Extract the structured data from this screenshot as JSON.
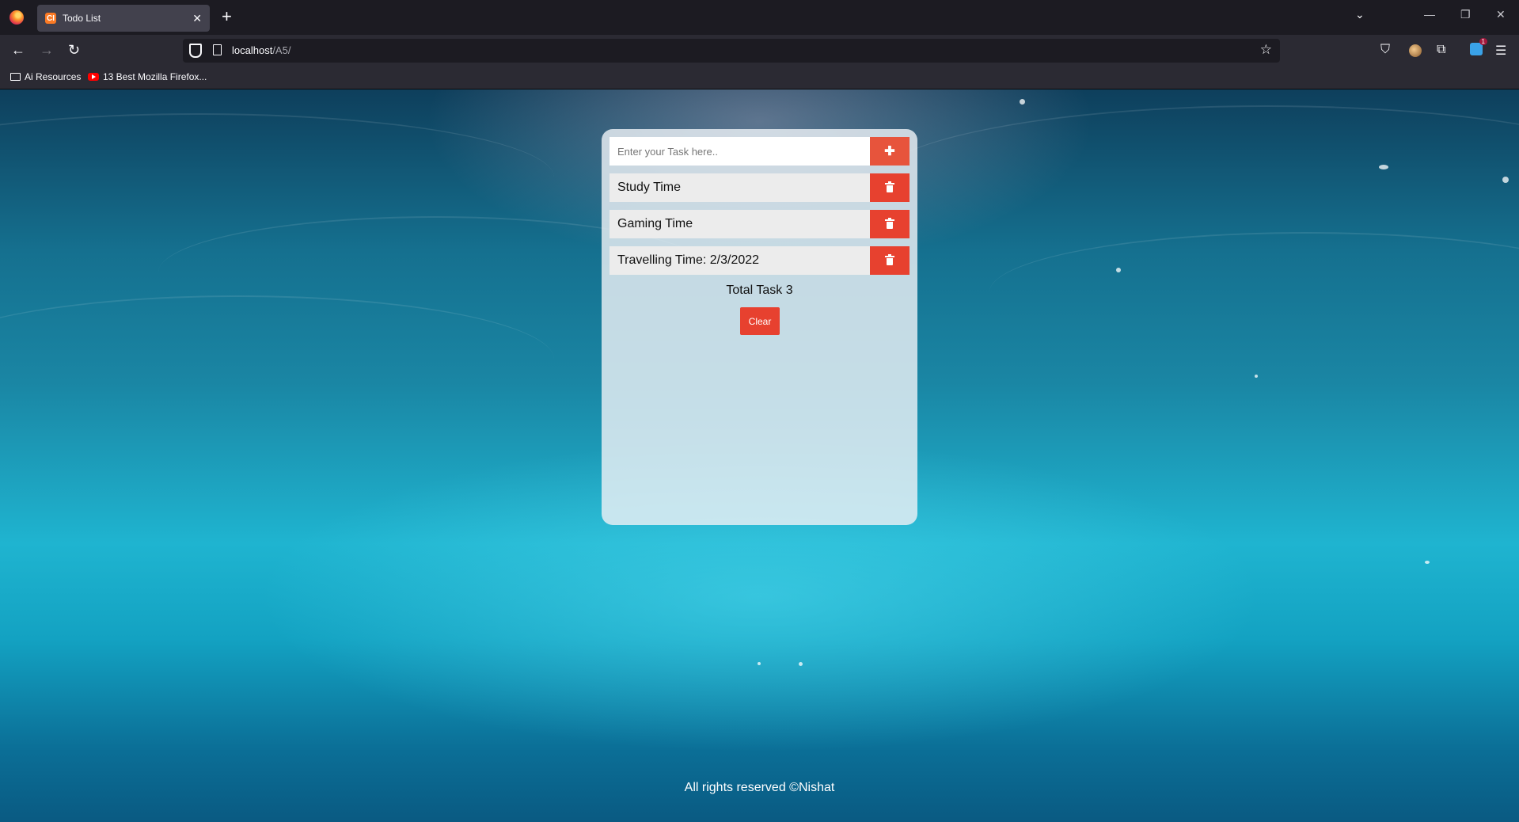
{
  "browser": {
    "tab_title": "Todo List",
    "tab_favicon": "CI",
    "url_host": "localhost",
    "url_path": "/A5/",
    "bookmarks": [
      "Ai Resources",
      "13 Best Mozilla Firefox..."
    ],
    "extension_badge_count": "1"
  },
  "app": {
    "input_placeholder": "Enter your Task here..",
    "add_icon": "plus-icon",
    "tasks": [
      {
        "text": "Study Time"
      },
      {
        "text": "Gaming Time"
      },
      {
        "text": "Travelling Time: 2/3/2022"
      }
    ],
    "total_label": "Total Task 3",
    "clear_label": "Clear",
    "accent_color": "#e7412f"
  },
  "footer": {
    "text": "All rights reserved ©Nishat"
  }
}
